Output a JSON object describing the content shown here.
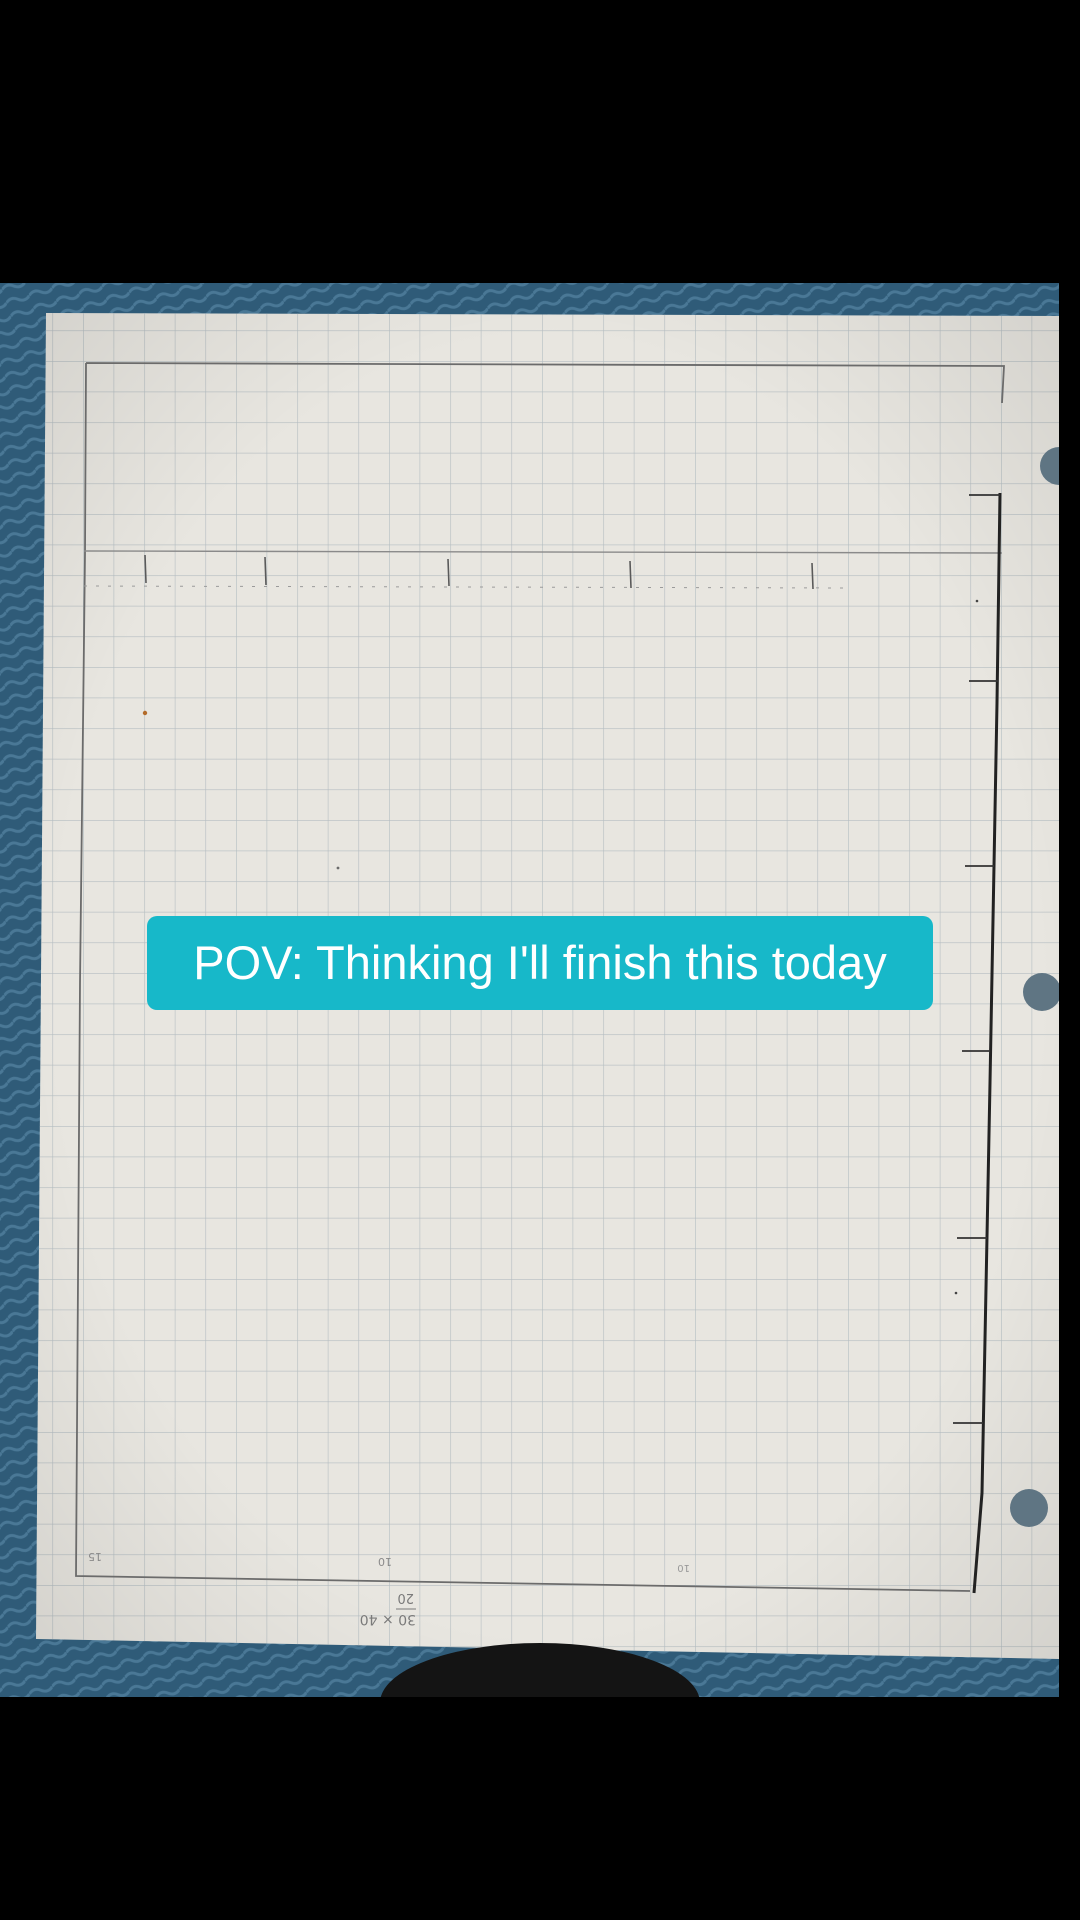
{
  "caption": {
    "text": "POV: Thinking I'll finish this today",
    "background": "#17b8c9",
    "color": "#ffffff"
  },
  "photo": {
    "subject": "graph-paper-sheet",
    "paper_color": "#e8e6e0",
    "background_color": "#2f5b78",
    "margin_notes": {
      "corner": "15",
      "bottom_mid": "10",
      "bottom_right": "10",
      "formula_top": "30 × 40",
      "formula_bottom": "20"
    }
  }
}
